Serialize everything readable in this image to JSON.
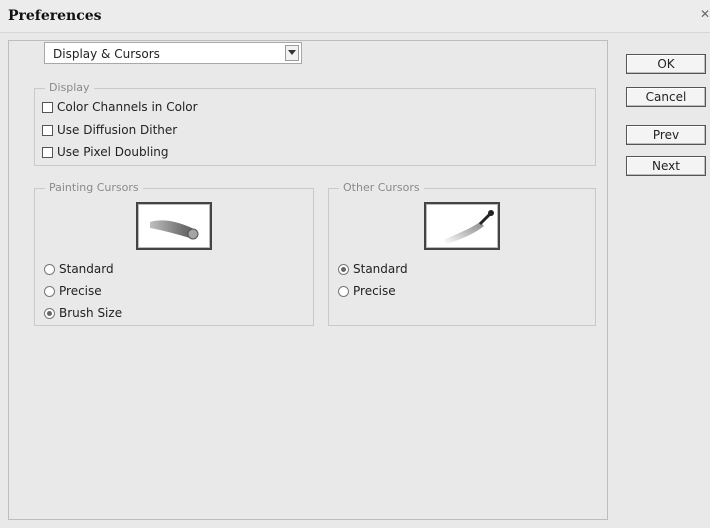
{
  "window": {
    "title": "Preferences"
  },
  "category": {
    "selected": "Display & Cursors"
  },
  "display_group": {
    "label": "Display",
    "options": [
      {
        "label": "Color Channels in Color",
        "checked": false
      },
      {
        "label": "Use Diffusion Dither",
        "checked": false
      },
      {
        "label": "Use Pixel Doubling",
        "checked": false
      }
    ]
  },
  "painting_cursors": {
    "label": "Painting Cursors",
    "options": [
      {
        "label": "Standard",
        "selected": false
      },
      {
        "label": "Precise",
        "selected": false
      },
      {
        "label": "Brush Size",
        "selected": true
      }
    ]
  },
  "other_cursors": {
    "label": "Other Cursors",
    "options": [
      {
        "label": "Standard",
        "selected": true
      },
      {
        "label": "Precise",
        "selected": false
      }
    ]
  },
  "buttons": {
    "ok": "OK",
    "cancel": "Cancel",
    "prev": "Prev",
    "next": "Next"
  },
  "icons": {
    "close": "close-icon",
    "dropdown": "chevron-down-icon",
    "brush_preview": "brush-cursor-icon",
    "eyedropper_preview": "eyedropper-icon"
  }
}
